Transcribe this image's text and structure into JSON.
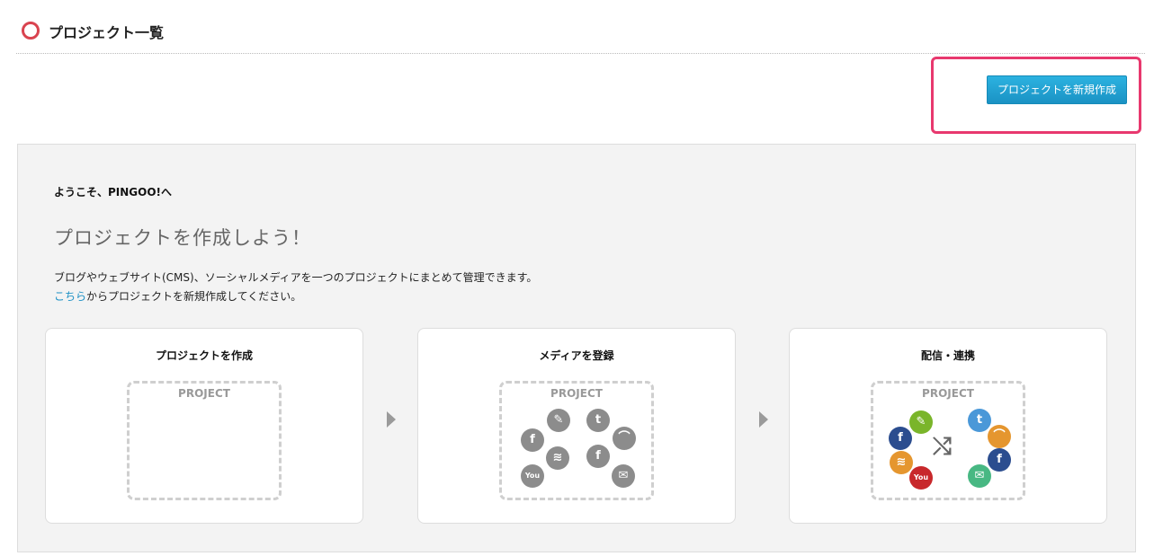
{
  "header": {
    "title": "プロジェクト一覧"
  },
  "new_project_button": {
    "label": "プロジェクトを新規作成"
  },
  "intro": {
    "welcome": "ようこそ、PINGOO!へ",
    "headline": "プロジェクトを作成しよう！",
    "description": "ブログやウェブサイト(CMS)、ソーシャルメディアを一つのプロジェクトにまとめて管理できます。",
    "link_text": "こちら",
    "link_suffix": "からプロジェクトを新規作成してください。"
  },
  "steps": [
    {
      "title": "プロジェクトを作成",
      "box_label": "PROJECT"
    },
    {
      "title": "メディアを登録",
      "box_label": "PROJECT"
    },
    {
      "title": "配信・連携",
      "box_label": "PROJECT"
    }
  ],
  "icons": {
    "pencil": "✎",
    "twitter": "t",
    "facebook": "f",
    "rss": "≋",
    "feed": "⌒",
    "mail": "✉",
    "youtube": "You",
    "shuffle": "⤭"
  },
  "colors": {
    "accent": "#1a92c4",
    "highlight": "#e8386e",
    "header_icon": "#d9434f",
    "pencil": "#7ab52a",
    "twitter": "#4a98d8",
    "facebook": "#2b4d8f",
    "rss": "#e5962f",
    "youtube": "#c8282b",
    "mail": "#48b883"
  }
}
